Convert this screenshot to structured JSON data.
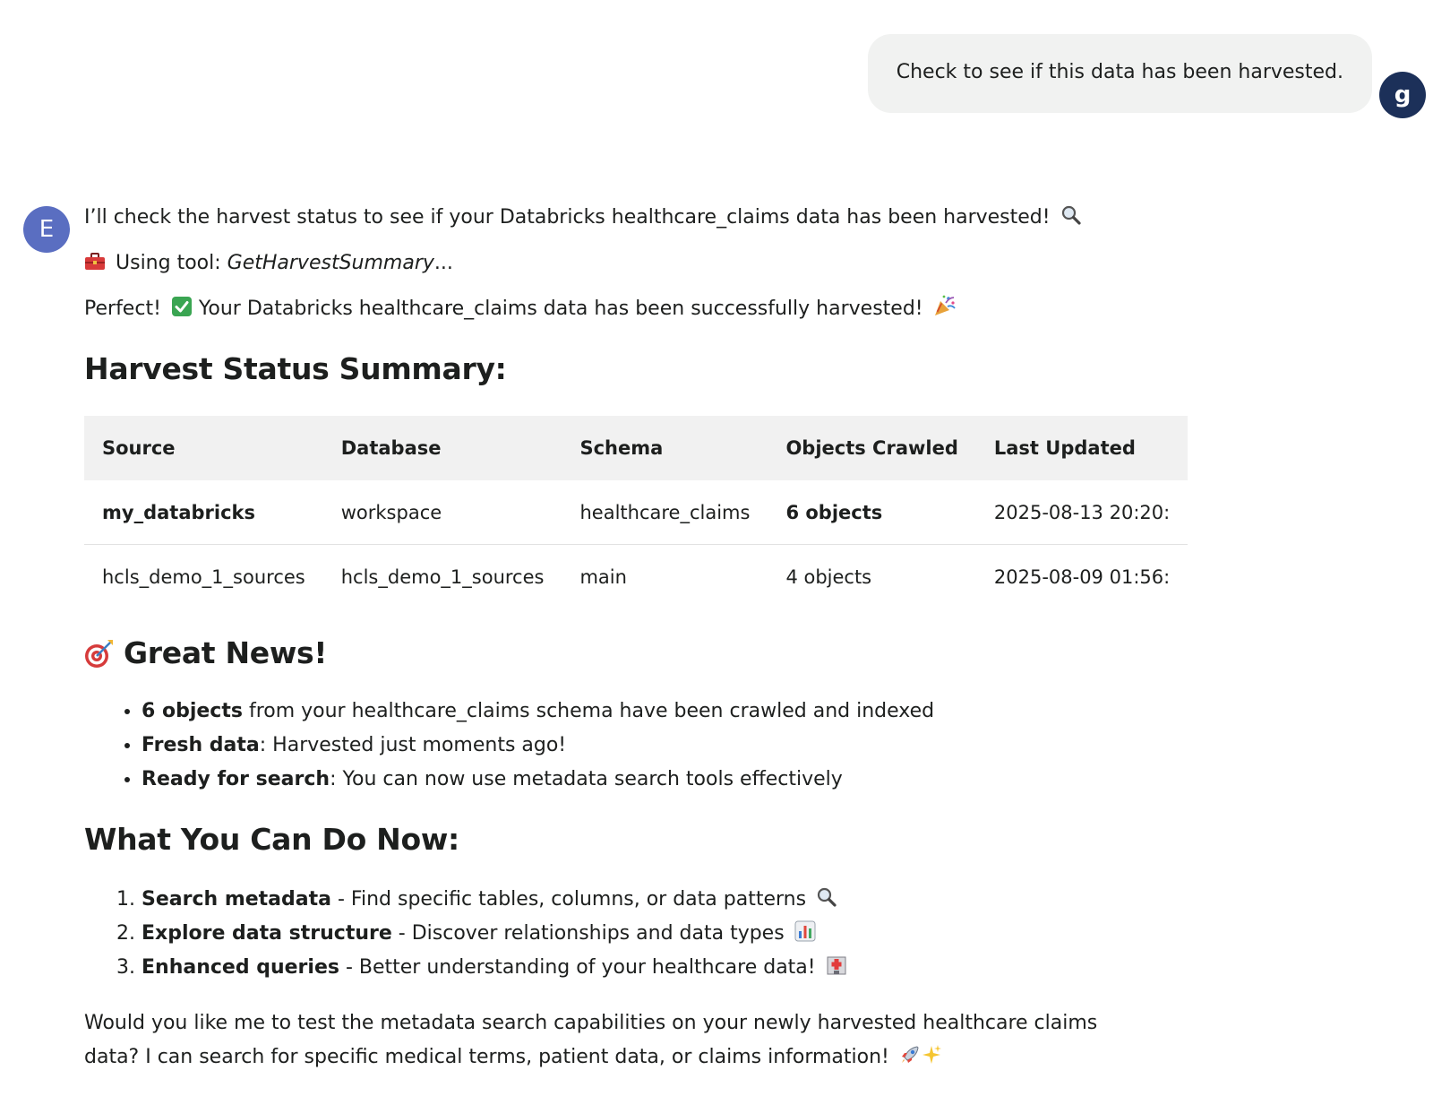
{
  "user_message": {
    "text": "Check to see if this data has been harvested.",
    "avatar_letter": "g"
  },
  "assistant": {
    "avatar_letter": "E",
    "intro": "I’ll check the harvest status to see if your Databricks healthcare_claims data has been harvested!",
    "tool_prefix": "Using tool:",
    "tool_name": "GetHarvestSummary",
    "tool_suffix": "...",
    "perfect_lead": "Perfect!",
    "perfect_text": "Your Databricks healthcare_claims data has been successfully harvested!",
    "summary_heading": "Harvest Status Summary:",
    "table": {
      "headers": [
        "Source",
        "Database",
        "Schema",
        "Objects Crawled",
        "Last Updated"
      ],
      "rows": [
        [
          "my_databricks",
          "workspace",
          "healthcare_claims",
          "6 objects",
          "2025-08-13 20:20:"
        ],
        [
          "hcls_demo_1_sources",
          "hcls_demo_1_sources",
          "main",
          "4 objects",
          "2025-08-09 01:56:"
        ]
      ]
    },
    "news_heading": "Great News!",
    "news_items": [
      {
        "bold": "6 objects",
        "text": " from your healthcare_claims schema have been crawled and indexed"
      },
      {
        "bold": "Fresh data",
        "text": ": Harvested just moments ago!"
      },
      {
        "bold": "Ready for search",
        "text": ": You can now use metadata search tools effectively"
      }
    ],
    "what_heading": "What You Can Do Now:",
    "todo_items": [
      {
        "bold": "Search metadata",
        "text": " - Find specific tables, columns, or data patterns"
      },
      {
        "bold": "Explore data structure",
        "text": " - Discover relationships and data types"
      },
      {
        "bold": "Enhanced queries",
        "text": " - Better understanding of your healthcare data!"
      }
    ],
    "closing": "Would you like me to test the metadata search capabilities on your newly harvested healthcare claims data? I can search for specific medical terms, patient data, or claims information!"
  },
  "icons": {
    "magnifier": "magnifier-icon",
    "toolbox": "toolbox-icon",
    "check": "check-icon",
    "party": "party-popper-icon",
    "target": "target-icon",
    "chart": "bar-chart-icon",
    "hospital": "hospital-icon",
    "rocket": "rocket-icon",
    "sparkles": "sparkles-icon"
  },
  "colors": {
    "user_bubble": "#f1f2f1",
    "user_avatar": "#1c3059",
    "assistant_avatar": "#5a6ec1",
    "table_header": "#f1f1f1",
    "check_green": "#3aa552"
  }
}
